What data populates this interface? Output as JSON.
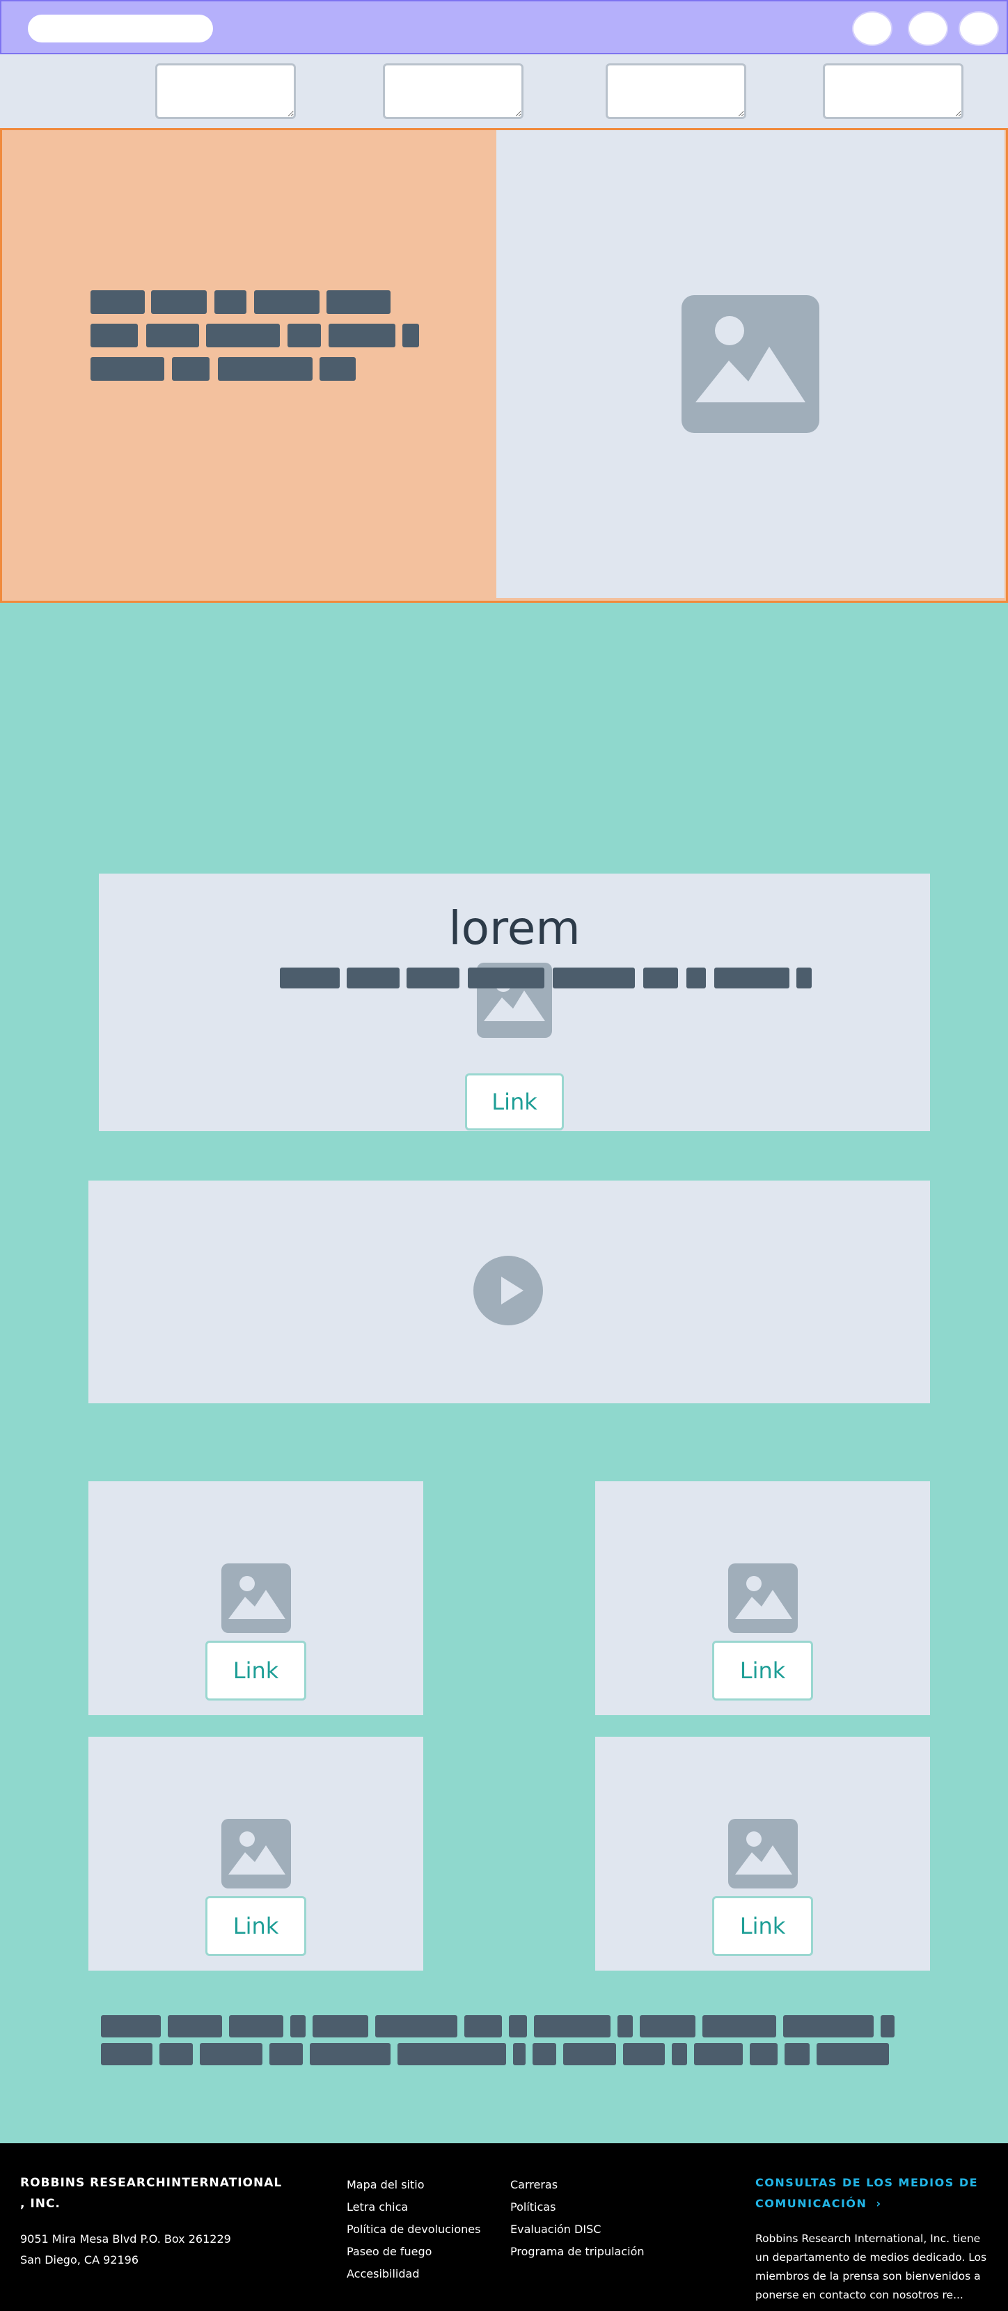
{
  "header": {
    "nav_fields": [
      "",
      "",
      "",
      ""
    ]
  },
  "hero": {},
  "feature": {
    "title": "lorem",
    "link_label": "Link"
  },
  "cards": [
    {
      "link_label": "Link"
    },
    {
      "link_label": "Link"
    },
    {
      "link_label": "Link"
    },
    {
      "link_label": "Link"
    }
  ],
  "footer": {
    "company": "ROBBINS RESEARCHINTERNATIONAL\n, INC.",
    "company_line1": "ROBBINS RESEARCHINTERNATIONAL",
    "company_line2": ", INC.",
    "address_line1": "9051 Mira Mesa Blvd P.O. Box 261229",
    "address_line2": "San Diego, CA 92196",
    "links_col1": [
      "Mapa del sitio",
      "Letra chica",
      "Política de devoluciones",
      "Paseo de fuego",
      "Accesibilidad"
    ],
    "links_col2": [
      "Carreras",
      "Políticas",
      "Evaluación DISC",
      "Programa de tripulación"
    ],
    "media_heading_line1": "CONSULTAS DE LOS MEDIOS DE",
    "media_heading_line2": "COMUNICACIÓN",
    "media_text": "Robbins Research International, Inc. tiene un departamento de medios dedicado. Los miembros de la prensa son bienvenidos a ponerse en contacto con nosotros re...",
    "colors": {
      "accent": "#22b5e6",
      "background": "#000000"
    }
  },
  "colors": {
    "header_bg": "#b5b0fb",
    "subnav_bg": "#e0e6ef",
    "hero_left_bg": "#f3c19e",
    "hero_border": "#f08a3c",
    "main_bg": "#8fd8cd",
    "panel_bg": "#e0e6ef",
    "link_text": "#1e9e96",
    "text_bar": "#4c5d6c"
  }
}
